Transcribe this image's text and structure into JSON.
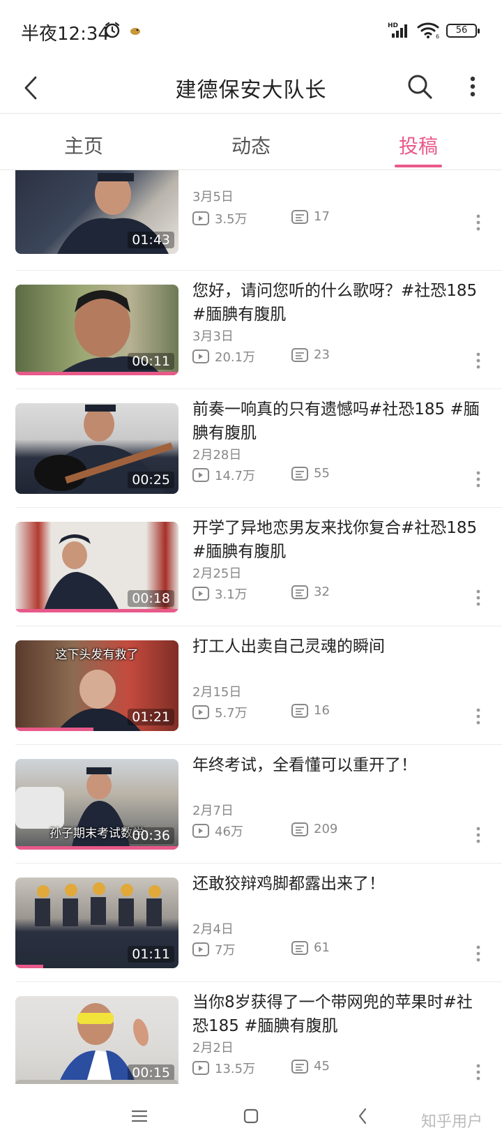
{
  "status_bar": {
    "time": "半夜12:34",
    "battery": "56",
    "icons": [
      "alarm-icon",
      "notification-bird-icon",
      "hd-signal-icon",
      "wifi-icon",
      "battery-icon"
    ]
  },
  "header": {
    "title": "建德保安大队长",
    "icons": [
      "back-arrow-icon",
      "search-icon",
      "more-vertical-icon"
    ]
  },
  "tabs": [
    {
      "label": "主页",
      "active": false
    },
    {
      "label": "动态",
      "active": false
    },
    {
      "label": "投稿",
      "active": true
    }
  ],
  "accent_color": "#e8598a",
  "videos": [
    {
      "title": "",
      "date": "3月5日",
      "views": "3.5万",
      "comments": "17",
      "duration": "01:43",
      "progress": 0
    },
    {
      "title": "您好，请问您听的什么歌呀？#社恐185 #腼腆有腹肌",
      "date": "3月3日",
      "views": "20.1万",
      "comments": "23",
      "duration": "00:11",
      "progress": 1.0
    },
    {
      "title": "前奏一响真的只有遗憾吗#社恐185 #腼腆有腹肌",
      "date": "2月28日",
      "views": "14.7万",
      "comments": "55",
      "duration": "00:25",
      "progress": 0
    },
    {
      "title": "开学了异地恋男友来找你复合#社恐185 #腼腆有腹肌",
      "date": "2月25日",
      "views": "3.1万",
      "comments": "32",
      "duration": "00:18",
      "progress": 1.0
    },
    {
      "title": "打工人出卖自己灵魂的瞬间",
      "date": "2月15日",
      "views": "5.7万",
      "comments": "16",
      "duration": "01:21",
      "progress": 0.48,
      "caption": "这下头发有救了"
    },
    {
      "title": "年终考试，全看懂可以重开了！",
      "date": "2月7日",
      "views": "46万",
      "comments": "209",
      "duration": "00:36",
      "progress": 1.0,
      "caption": "孙子期末考试数学"
    },
    {
      "title": "还敢狡辩鸡脚都露出来了！",
      "date": "2月4日",
      "views": "7万",
      "comments": "61",
      "duration": "01:11",
      "progress": 0.17
    },
    {
      "title": "当你8岁获得了一个带网兜的苹果时#社恐185 #腼腆有腹肌",
      "date": "2月2日",
      "views": "13.5万",
      "comments": "45",
      "duration": "00:15",
      "progress": 1.0
    }
  ],
  "nav_bar": {
    "icons": [
      "menu-icon",
      "home-square-icon",
      "back-icon"
    ],
    "watermark": "知乎用户"
  }
}
